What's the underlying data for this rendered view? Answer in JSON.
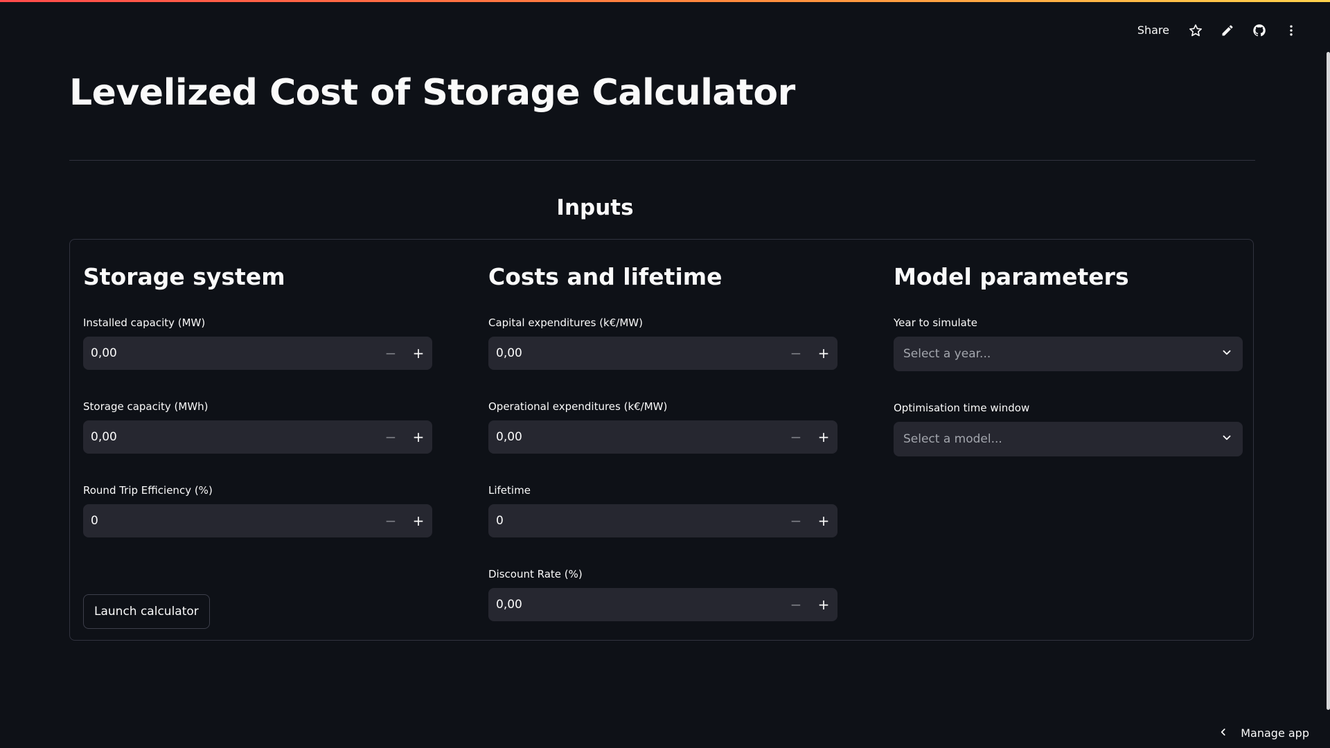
{
  "header": {
    "share_label": "Share",
    "icons": [
      "star-icon",
      "pencil-icon",
      "github-icon",
      "more-vertical-icon"
    ]
  },
  "page": {
    "title": "Levelized Cost of Storage Calculator",
    "section_title": "Inputs"
  },
  "columns": {
    "storage": {
      "title": "Storage system",
      "fields": [
        {
          "label": "Installed capacity (MW)",
          "value": "0,00"
        },
        {
          "label": "Storage capacity (MWh)",
          "value": "0,00"
        },
        {
          "label": "Round Trip Efficiency (%)",
          "value": "0"
        }
      ]
    },
    "costs": {
      "title": "Costs and lifetime",
      "fields": [
        {
          "label": "Capital expenditures (k€/MW)",
          "value": "0,00"
        },
        {
          "label": "Operational expenditures (k€/MW)",
          "value": "0,00"
        },
        {
          "label": "Lifetime",
          "value": "0"
        },
        {
          "label": "Discount Rate (%)",
          "value": "0,00"
        }
      ]
    },
    "model": {
      "title": "Model parameters",
      "selects": [
        {
          "label": "Year to simulate",
          "placeholder": "Select a year..."
        },
        {
          "label": "Optimisation time window",
          "placeholder": "Select a model..."
        }
      ]
    }
  },
  "buttons": {
    "launch_label": "Launch calculator"
  },
  "footer": {
    "manage_label": "Manage app"
  },
  "colors": {
    "background": "#0e1117",
    "input_bg": "#262730",
    "border": "#31333f",
    "text": "#fafafa",
    "accent_start": "#ff4b4b",
    "accent_end": "#ffd24c"
  }
}
